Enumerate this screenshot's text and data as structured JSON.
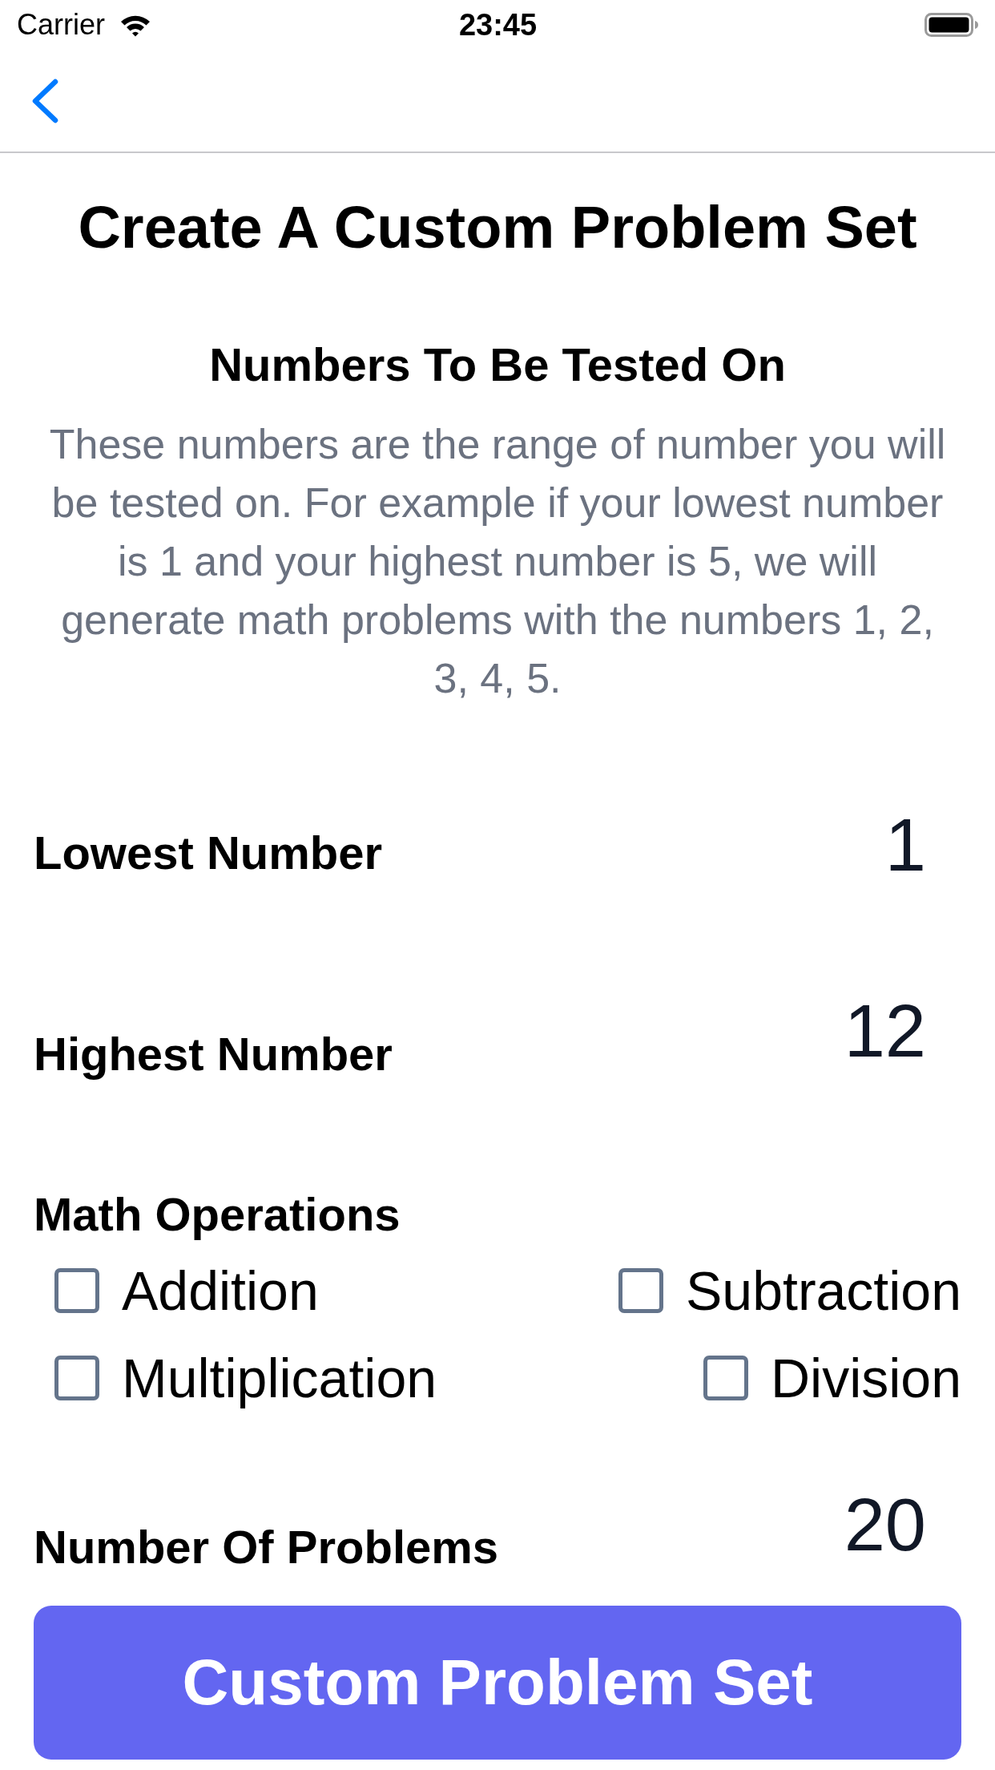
{
  "status_bar": {
    "carrier": "Carrier",
    "time": "23:45"
  },
  "title": "Create A Custom Problem Set",
  "range_section": {
    "heading": "Numbers To Be Tested On",
    "description": "These numbers are the range of number you will be tested on. For example if your lowest number is 1 and your highest number is 5, we will generate math problems with the numbers 1, 2, 3, 4, 5."
  },
  "fields": [
    {
      "label": "Lowest Number",
      "value": "1"
    },
    {
      "label": "Highest Number",
      "value": "12"
    }
  ],
  "math_operations": {
    "heading": "Math Operations",
    "options": [
      {
        "label": "Addition",
        "checked": false
      },
      {
        "label": "Subtraction",
        "checked": false
      },
      {
        "label": "Multiplication",
        "checked": false
      },
      {
        "label": "Division",
        "checked": false
      }
    ]
  },
  "problem_count": {
    "label": "Number Of Problems",
    "value": "20"
  },
  "submit_button": {
    "label": "Custom Problem Set"
  }
}
